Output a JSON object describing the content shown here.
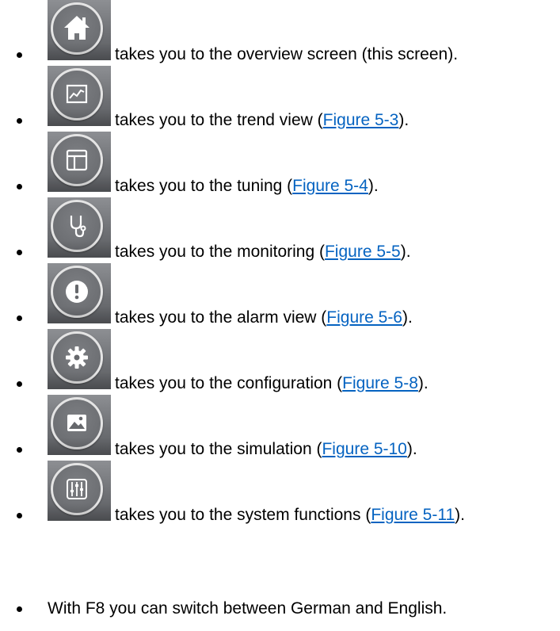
{
  "items": [
    {
      "icon": "home-icon",
      "text": "takes you to the overview screen (this screen).",
      "link": "",
      "suffix": ""
    },
    {
      "icon": "trend-chart-icon",
      "text": "takes you to the trend view (",
      "link": "Figure 5-3",
      "suffix": ")."
    },
    {
      "icon": "tuning-layout-icon",
      "text": "takes you to the tuning (",
      "link": "Figure 5-4",
      "suffix": ")."
    },
    {
      "icon": "stethoscope-icon",
      "text": "takes you to the monitoring (",
      "link": "Figure 5-5",
      "suffix": ")."
    },
    {
      "icon": "alarm-warning-icon",
      "text": "takes you to the alarm view (",
      "link": "Figure 5-6",
      "suffix": ")."
    },
    {
      "icon": "gear-icon",
      "text": "takes you to the configuration (",
      "link": "Figure 5-8",
      "suffix": ")."
    },
    {
      "icon": "image-simulation-icon",
      "text": "takes you to the simulation (",
      "link": "Figure 5-10",
      "suffix": ")."
    },
    {
      "icon": "sliders-icon",
      "text": "takes you to the system functions (",
      "link": "Figure 5-11",
      "suffix": ")."
    }
  ],
  "final_note": "With F8 you can switch between German and English.",
  "colors": {
    "link": "#0563c1",
    "icon_tile": "#6f7175",
    "icon_ring": "#e4e4e4"
  }
}
